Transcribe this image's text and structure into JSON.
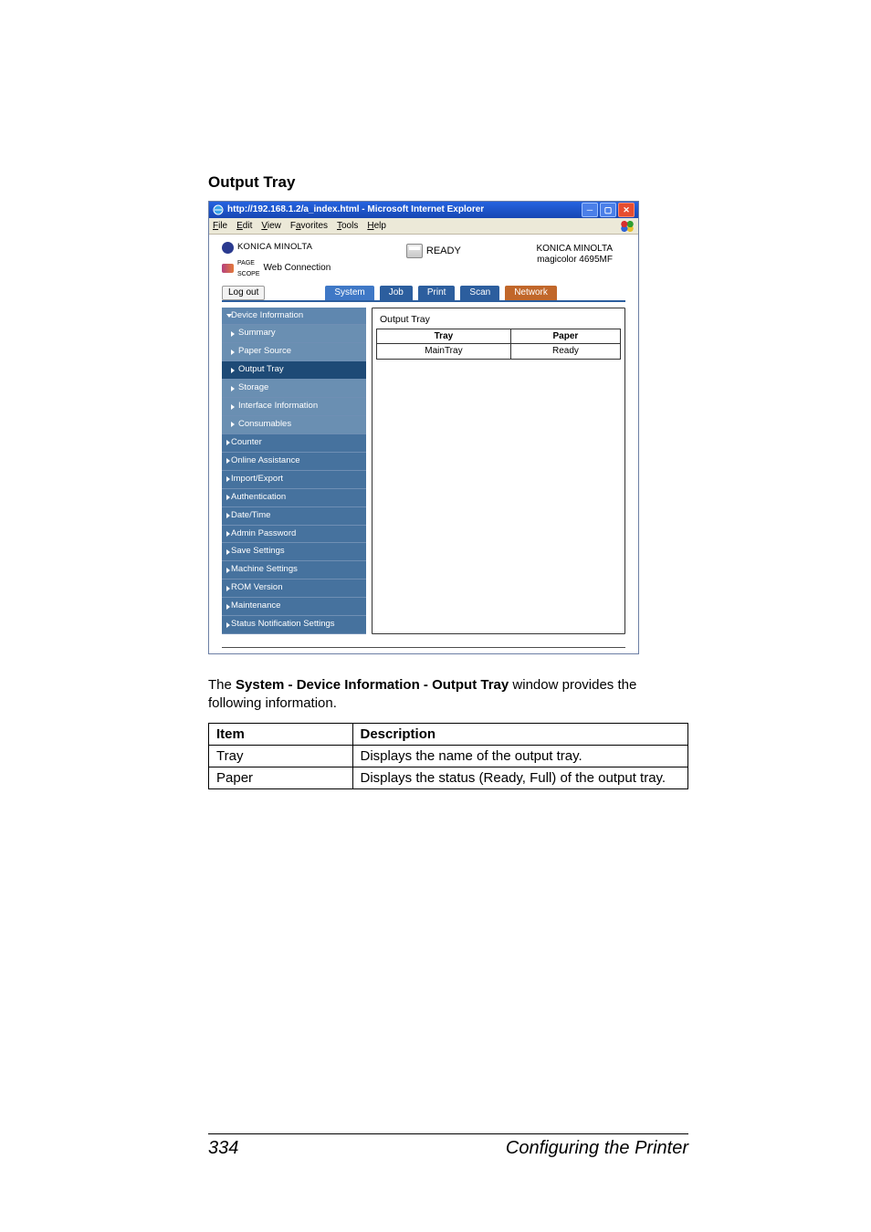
{
  "section_title": "Output Tray",
  "browser": {
    "title": "http://192.168.1.2/a_index.html - Microsoft Internet Explorer",
    "menus": {
      "file": "File",
      "edit": "Edit",
      "view": "View",
      "favorites": "Favorites",
      "tools": "Tools",
      "help": "Help"
    }
  },
  "brand": {
    "maker": "KONICA MINOLTA",
    "pagescope": "PageScope",
    "webconn": "Web Connection"
  },
  "status": {
    "label": "READY"
  },
  "model": {
    "maker": "KONICA MINOLTA",
    "name": "magicolor 4695MF"
  },
  "logout": "Log out",
  "tabs": {
    "system": "System",
    "job": "Job",
    "print": "Print",
    "scan": "Scan",
    "network": "Network"
  },
  "nav": {
    "device_info": "Device Information",
    "summary": "Summary",
    "paper_source": "Paper Source",
    "output_tray": "Output Tray",
    "storage": "Storage",
    "interface_info": "Interface Information",
    "consumables": "Consumables",
    "counter": "Counter",
    "online_assist": "Online Assistance",
    "import_export": "Import/Export",
    "authentication": "Authentication",
    "date_time": "Date/Time",
    "admin_pw": "Admin Password",
    "save_settings": "Save Settings",
    "machine_settings": "Machine Settings",
    "rom_version": "ROM Version",
    "maintenance": "Maintenance",
    "status_notif": "Status Notification Settings"
  },
  "pane": {
    "title": "Output Tray",
    "col_tray": "Tray",
    "col_paper": "Paper",
    "row_tray": "MainTray",
    "row_paper": "Ready"
  },
  "description": {
    "pre": "The ",
    "bold": "System - Device Information - Output Tray",
    "post": " window provides the following information."
  },
  "desc_table": {
    "h_item": "Item",
    "h_desc": "Description",
    "r1_item": "Tray",
    "r1_desc": "Displays the name of the output tray.",
    "r2_item": "Paper",
    "r2_desc": "Displays the status (Ready, Full) of the output tray."
  },
  "footer": {
    "page": "334",
    "chapter": "Configuring the Printer"
  }
}
